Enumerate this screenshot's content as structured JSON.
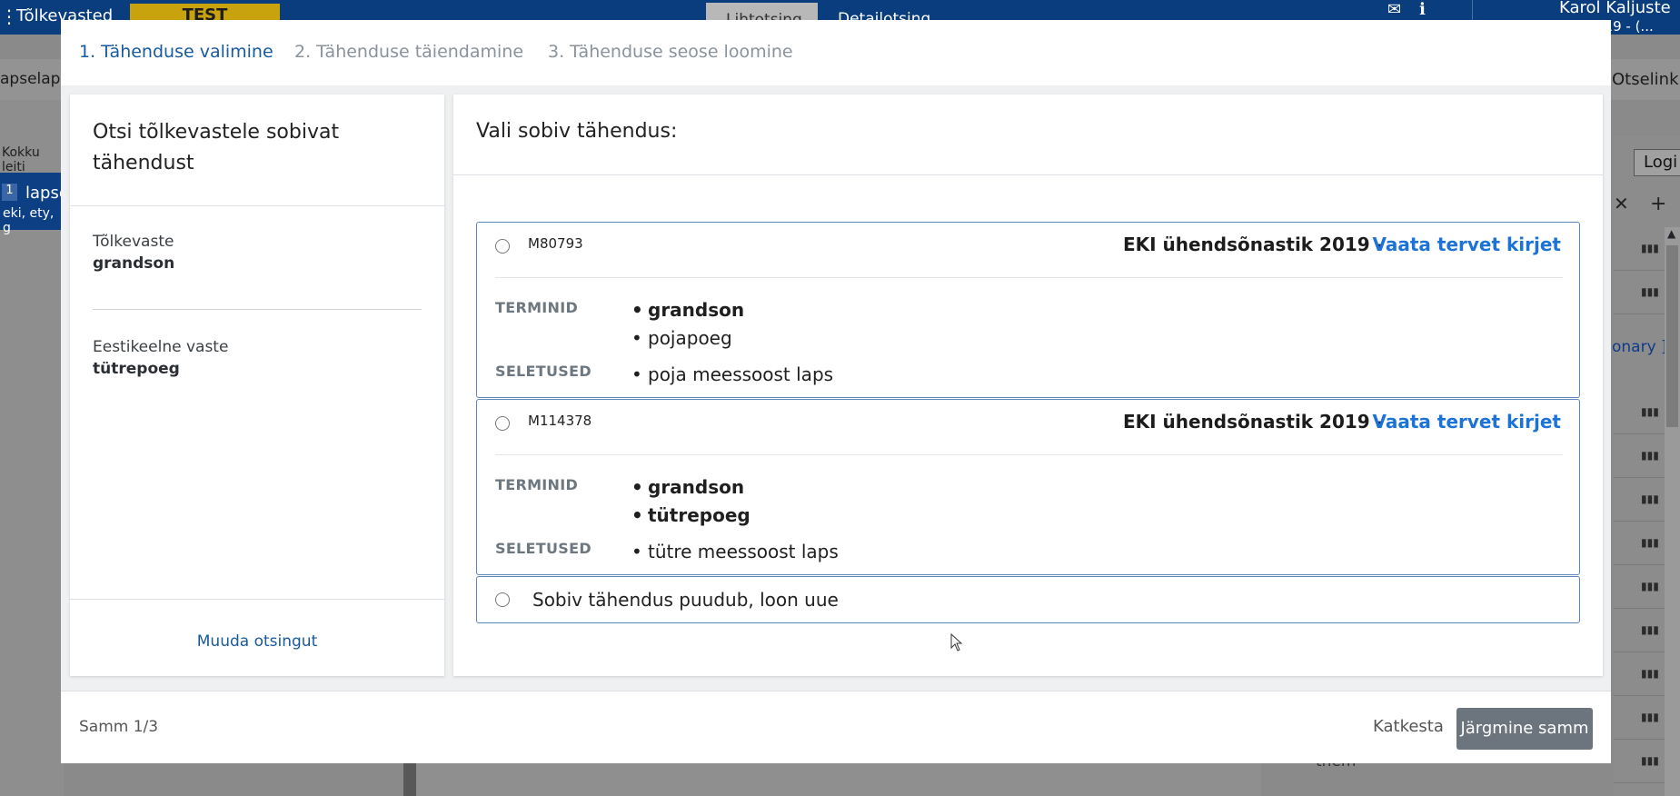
{
  "background": {
    "topbar": {
      "menu_glyph": "⋮",
      "title": "Tõlkevasted",
      "env_badge": "TEST",
      "tabs": [
        "Lihtotsing",
        "Detailotsing"
      ],
      "user_name": "Karol Kaljuste",
      "user_sub": "019 - (...",
      "icons": [
        "mail-icon",
        "info-icon"
      ]
    },
    "subbar": {
      "left_text": "apselap",
      "right_link": "Otselink"
    },
    "leftpanel": {
      "count": "Kokku leiti",
      "badge": "1",
      "word": "lapse",
      "small": "eki, ety, g"
    },
    "rightpanel": {
      "logi_button": "Logi",
      "dict_link": "onary ]",
      "bottom_word": "them"
    }
  },
  "modal": {
    "steps": [
      {
        "label": "1. Tähenduse valimine",
        "active": true
      },
      {
        "label": "2. Tähenduse täiendamine",
        "active": false
      },
      {
        "label": "3. Tähenduse seose loomine",
        "active": false
      }
    ],
    "left": {
      "heading": "Otsi tõlkevastele sobivat tähendust",
      "translation_label": "Tõlkevaste",
      "translation_value": "grandson",
      "estonian_label": "Eestikeelne vaste",
      "estonian_value": "tütrepoeg",
      "change_search": "Muuda otsingut"
    },
    "right": {
      "heading": "Vali sobiv tähendus:",
      "options": [
        {
          "meaning_id": "M80793",
          "dictionary": "EKI ühendsõnastik 2019 -",
          "view_link": "Vaata tervet kirjet",
          "terms_label": "TERMINID",
          "terms": [
            {
              "text": "grandson",
              "bold": true
            },
            {
              "text": "pojapoeg",
              "bold": false
            }
          ],
          "definitions_label": "SELETUSED",
          "definitions": [
            "poja meessoost laps"
          ]
        },
        {
          "meaning_id": "M114378",
          "dictionary": "EKI ühendsõnastik 2019 -",
          "view_link": "Vaata tervet kirjet",
          "terms_label": "TERMINID",
          "terms": [
            {
              "text": "grandson",
              "bold": true
            },
            {
              "text": "tütrepoeg",
              "bold": true
            }
          ],
          "definitions_label": "SELETUSED",
          "definitions": [
            "tütre meessoost laps"
          ]
        }
      ],
      "no_match_option": "Sobiv tähendus puudub, loon uue"
    },
    "footer": {
      "step_counter": "Samm 1/3",
      "cancel_button": "Katkesta",
      "next_button": "Järgmine samm"
    }
  },
  "colors": {
    "primary_blue": "#175a9f",
    "link_blue": "#1b73d8",
    "topbar_blue": "#0a3d7e",
    "next_button_gray": "#6c757d",
    "option_border": "#5d86b8"
  }
}
